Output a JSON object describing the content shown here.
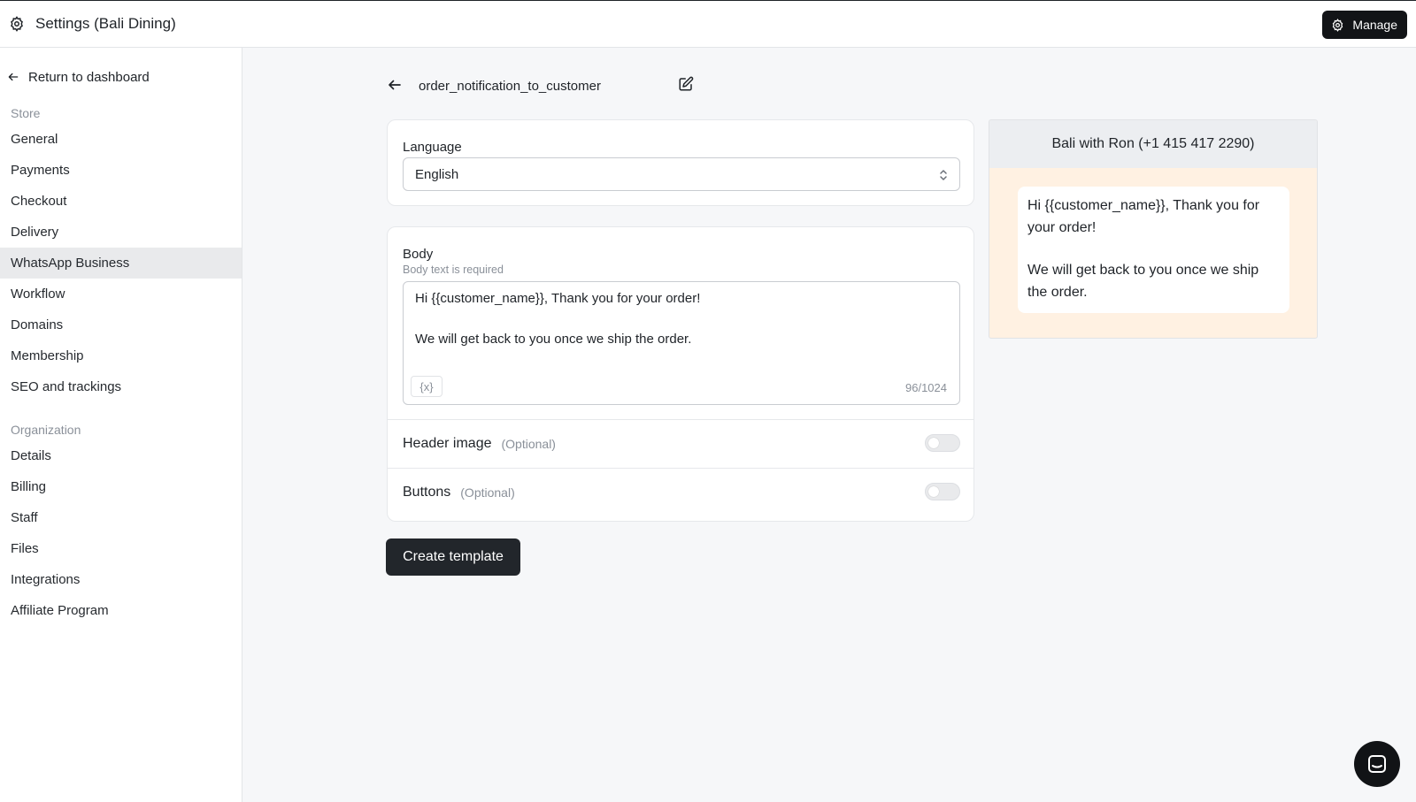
{
  "topbar": {
    "title": "Settings (Bali Dining)",
    "manage_label": "Manage"
  },
  "sidebar": {
    "return_label": "Return to dashboard",
    "store_label": "Store",
    "store_items": [
      {
        "label": "General"
      },
      {
        "label": "Payments"
      },
      {
        "label": "Checkout"
      },
      {
        "label": "Delivery"
      },
      {
        "label": "WhatsApp Business",
        "active": true
      },
      {
        "label": "Workflow"
      },
      {
        "label": "Domains"
      },
      {
        "label": "Membership"
      },
      {
        "label": "SEO and trackings"
      }
    ],
    "org_label": "Organization",
    "org_items": [
      {
        "label": "Details"
      },
      {
        "label": "Billing"
      },
      {
        "label": "Staff"
      },
      {
        "label": "Files"
      },
      {
        "label": "Integrations"
      },
      {
        "label": "Affiliate Program"
      }
    ]
  },
  "template": {
    "name": "order_notification_to_customer",
    "language_label": "Language",
    "language_value": "English",
    "body_label": "Body",
    "body_hint": "Body text is required",
    "body_line1": "Hi {{customer_name}}, Thank you for your order!",
    "body_line2": "We will get back to you once we ship the order.",
    "variable_button": "{x}",
    "counter": "96/1024",
    "header_image_label": "Header image",
    "header_image_optional": "(Optional)",
    "buttons_label": "Buttons",
    "buttons_optional": "(Optional)",
    "create_label": "Create template"
  },
  "preview": {
    "header": "Bali with Ron (+1 415 417 2290)",
    "line1": "Hi {{customer_name}}, Thank you for your order!",
    "line2": "We will get back to you once we ship the order."
  },
  "colors": {
    "accent": "#22262b",
    "preview_bg": "#fff1e2",
    "active_nav": "#e9eaec"
  }
}
